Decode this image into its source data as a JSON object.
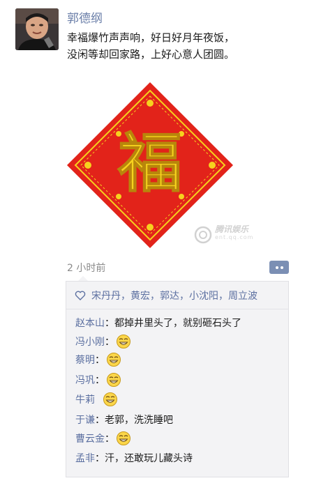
{
  "post": {
    "author": "郭德纲",
    "text_line1": "幸福爆竹声声响，好日好月年夜饭，",
    "text_line2": "没闲等却回家路，上好心意人团圆。",
    "image_glyph": "福",
    "timestamp": "2 小时前"
  },
  "watermark": {
    "text": "腾讯娱乐",
    "sub": "ent.qq.com"
  },
  "likes": {
    "names": [
      "宋丹丹",
      "黄宏",
      "郭达",
      "小沈阳",
      "周立波"
    ],
    "separator": "，"
  },
  "comments": [
    {
      "name": "赵本山",
      "colon": "：",
      "text": "都掉井里头了，就别砸石头了",
      "emoji": false
    },
    {
      "name": "冯小刚",
      "colon": "：",
      "text": "",
      "emoji": true
    },
    {
      "name": "蔡明",
      "colon": "：",
      "text": "",
      "emoji": true
    },
    {
      "name": "冯巩",
      "colon": "：",
      "text": "",
      "emoji": true
    },
    {
      "name": "牛莉",
      "colon": "  ",
      "text": "",
      "emoji": true
    },
    {
      "name": "于谦",
      "colon": "：",
      "text": "老郭，洗洗睡吧",
      "emoji": false
    },
    {
      "name": "曹云金",
      "colon": "：",
      "text": "",
      "emoji": true
    },
    {
      "name": "孟非",
      "colon": "：",
      "text": "汗，还敢玩儿藏头诗",
      "emoji": false
    }
  ],
  "colors": {
    "link": "#5b6fa0",
    "fu_red": "#e2231a",
    "fu_gold": "#f6d21e"
  },
  "icons": {
    "comment": "comment-bubble-icon",
    "like": "heart-icon",
    "emoji": "grin-emoji-icon"
  }
}
